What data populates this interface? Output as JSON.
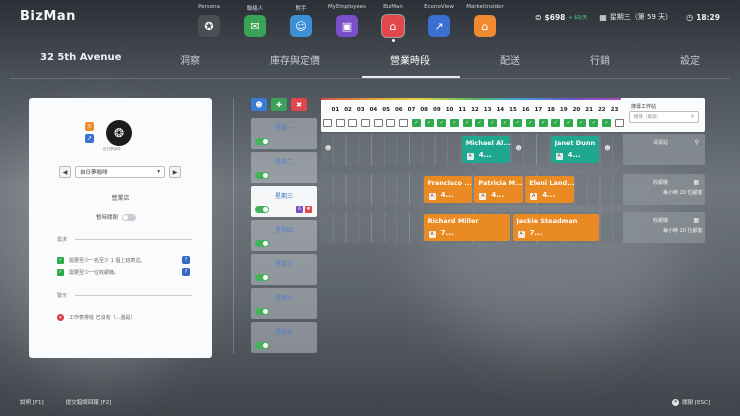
{
  "app": {
    "title": "BizMan"
  },
  "apps": [
    {
      "label": "Persona",
      "icon": "persona-icon",
      "glyph": "✪",
      "color": "#4b4f55"
    },
    {
      "label": "聯絡人",
      "icon": "chat-icon",
      "glyph": "✉",
      "color": "#3aa357"
    },
    {
      "label": "對手",
      "icon": "people-icon",
      "glyph": "☺",
      "color": "#3d8fd6"
    },
    {
      "label": "MyEmployees",
      "icon": "badge-icon",
      "glyph": "▣",
      "color": "#7a4fc9"
    },
    {
      "label": "BizMan",
      "icon": "store-icon",
      "glyph": "⌂",
      "color": "#e2474b",
      "active": true
    },
    {
      "label": "EconoView",
      "icon": "chart-icon",
      "glyph": "↗",
      "color": "#3b6fd1"
    },
    {
      "label": "MarketInsider",
      "icon": "house-icon",
      "glyph": "⌂",
      "color": "#ef8a2e"
    }
  ],
  "status": {
    "money": "$698",
    "delta": "+ $0/天",
    "date": "星期三（第 59 天）",
    "time": "18:29"
  },
  "tabs": [
    "32 5th Avenue",
    "洞察",
    "庫存與定價",
    "營業時段",
    "配送",
    "行銷",
    "設定"
  ],
  "left_panel": {
    "logo_caption": "自日夢咖啡",
    "business_select": "自日夢咖啡",
    "store_name": "營業店",
    "temp_closed_label": "暫時關閉",
    "requirements_title": "需求",
    "requirements": [
      "需要至少一名至少 1 個上班表這。",
      "需要至少一位收銀機。"
    ],
    "warnings_title": "警示",
    "warnings": [
      "工作表排班 已沒有（...還是）"
    ]
  },
  "tools": [
    {
      "icon": "assign-icon",
      "glyph": "☻",
      "color": "#3a7bd5"
    },
    {
      "icon": "add-person-icon",
      "glyph": "✚",
      "color": "#3aa357"
    },
    {
      "icon": "trash-icon",
      "glyph": "✖",
      "color": "#e0474b"
    }
  ],
  "days": [
    {
      "label": "星期一",
      "active": false,
      "badges": []
    },
    {
      "label": "星期二",
      "active": false,
      "badges": []
    },
    {
      "label": "星期三",
      "active": true,
      "badges": [
        {
          "glyph": "A",
          "color": "#7a4fc9"
        },
        {
          "glyph": "✖",
          "color": "#e0474b"
        }
      ]
    },
    {
      "label": "星期四",
      "active": false,
      "badges": []
    },
    {
      "label": "星期五",
      "active": false,
      "badges": []
    },
    {
      "label": "星期六",
      "active": false,
      "badges": []
    },
    {
      "label": "星期日",
      "active": false,
      "badges": []
    }
  ],
  "hours": {
    "labels": [
      "01",
      "02",
      "03",
      "04",
      "05",
      "06",
      "07",
      "08",
      "09",
      "10",
      "11",
      "12",
      "13",
      "14",
      "15",
      "16",
      "17",
      "18",
      "19",
      "20",
      "21",
      "22",
      "23"
    ],
    "checked": [
      false,
      false,
      false,
      false,
      false,
      false,
      false,
      true,
      true,
      true,
      true,
      true,
      true,
      true,
      true,
      true,
      true,
      true,
      true,
      true,
      true,
      true,
      true,
      false
    ]
  },
  "finder": {
    "title": "搜尋工作站",
    "placeholder": "搜尋（家族）"
  },
  "rows": [
    {
      "role": "清潔站",
      "sub": "",
      "role_icon": "broom-icon",
      "role_glyph": "⚲",
      "shifts": [
        {
          "name": "Michael Al...",
          "hours": "4...",
          "color": "teal",
          "start": 11,
          "len": 4
        },
        {
          "name": "Janet Dunn",
          "hours": "4...",
          "color": "teal",
          "start": 18,
          "len": 4
        }
      ],
      "empty_slots": [
        0,
        15,
        22
      ]
    },
    {
      "role": "收銀機",
      "sub": "每小時 20 位顧客",
      "role_icon": "register-icon",
      "role_glyph": "▦",
      "shifts": [
        {
          "name": "Francisco ...",
          "hours": "4...",
          "color": "orange",
          "start": 8,
          "len": 4
        },
        {
          "name": "Patricia M...",
          "hours": "4...",
          "color": "orange",
          "start": 12,
          "len": 4
        },
        {
          "name": "Eleni Land...",
          "hours": "4...",
          "color": "orange",
          "start": 16,
          "len": 4
        }
      ],
      "empty_slots": []
    },
    {
      "role": "收銀機",
      "sub": "每小時 20 位顧客",
      "role_icon": "register-icon",
      "role_glyph": "▦",
      "shifts": [
        {
          "name": "Richard Miller",
          "hours": "7...",
          "color": "orange",
          "start": 8,
          "len": 7
        },
        {
          "name": "Jackie Steadman",
          "hours": "7...",
          "color": "orange",
          "start": 15,
          "len": 7
        }
      ],
      "empty_slots": []
    }
  ],
  "footer": {
    "help": "說明 [F1]",
    "feedback": "提交錯誤回報 [F2]",
    "close": "關閉 [ESC]"
  }
}
